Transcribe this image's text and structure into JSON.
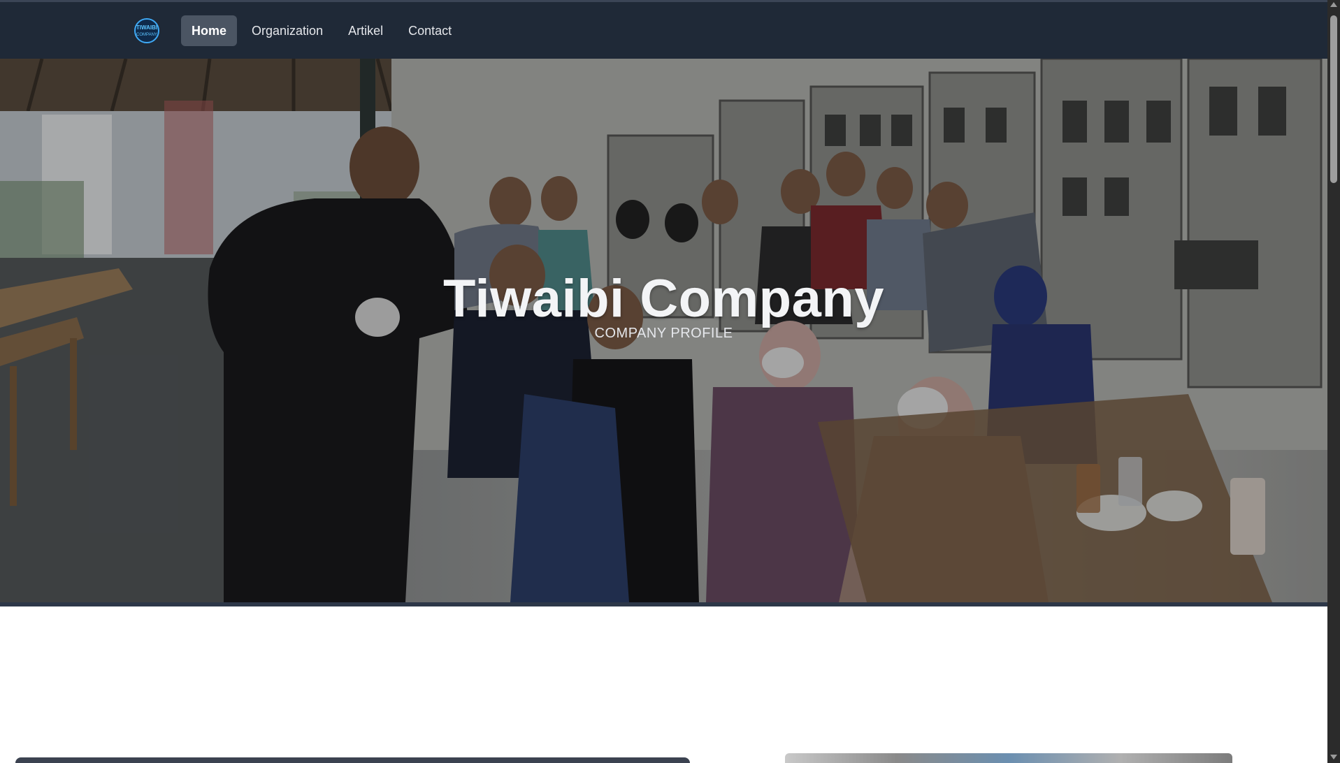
{
  "nav": {
    "logo_text": "TIWAIBI COMPANY",
    "items": [
      {
        "label": "Home",
        "active": true
      },
      {
        "label": "Organization",
        "active": false
      },
      {
        "label": "Artikel",
        "active": false
      },
      {
        "label": "Contact",
        "active": false
      }
    ]
  },
  "hero": {
    "title": "Tiwaibi Company",
    "subtitle": "COMPANY PROFILE",
    "image": "group-photo"
  },
  "colors": {
    "navbar": "#1f2937",
    "active_nav": "#4b5563",
    "title": "#f3f4f6"
  }
}
